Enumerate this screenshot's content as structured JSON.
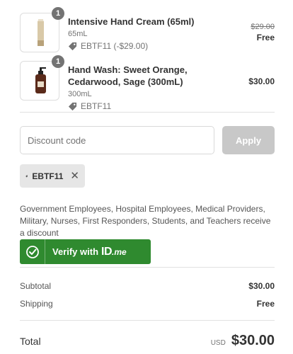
{
  "items": [
    {
      "quantity": "1",
      "name": "Intensive Hand Cream (65ml)",
      "variant": "65mL",
      "discount": "EBTF11 (-$29.00)",
      "original_price": "$29.00",
      "price": "Free"
    },
    {
      "quantity": "1",
      "name": "Hand Wash: Sweet Orange, Cedarwood, Sage (300mL)",
      "variant": "300mL",
      "discount": "EBTF11",
      "price": "$30.00"
    }
  ],
  "discount_form": {
    "placeholder": "Discount code",
    "apply_label": "Apply"
  },
  "applied_code": {
    "code": "EBTF11",
    "remove_glyph": "✕"
  },
  "idme": {
    "description": "Government Employees, Hospital Employees, Medical Providers, Military, Nurses, First Responders, Students, and Teachers receive a discount",
    "verify_label": "Verify with",
    "logo_id": "ID",
    "logo_me": ".me"
  },
  "summary": {
    "subtotal_label": "Subtotal",
    "subtotal_value": "$30.00",
    "shipping_label": "Shipping",
    "shipping_value": "Free",
    "total_label": "Total",
    "currency": "USD",
    "total_value": "$30.00"
  },
  "colors": {
    "idme_green": "#2f8a2f",
    "apply_disabled": "#c8c8c8",
    "chip_bg": "#e6e6e6"
  }
}
